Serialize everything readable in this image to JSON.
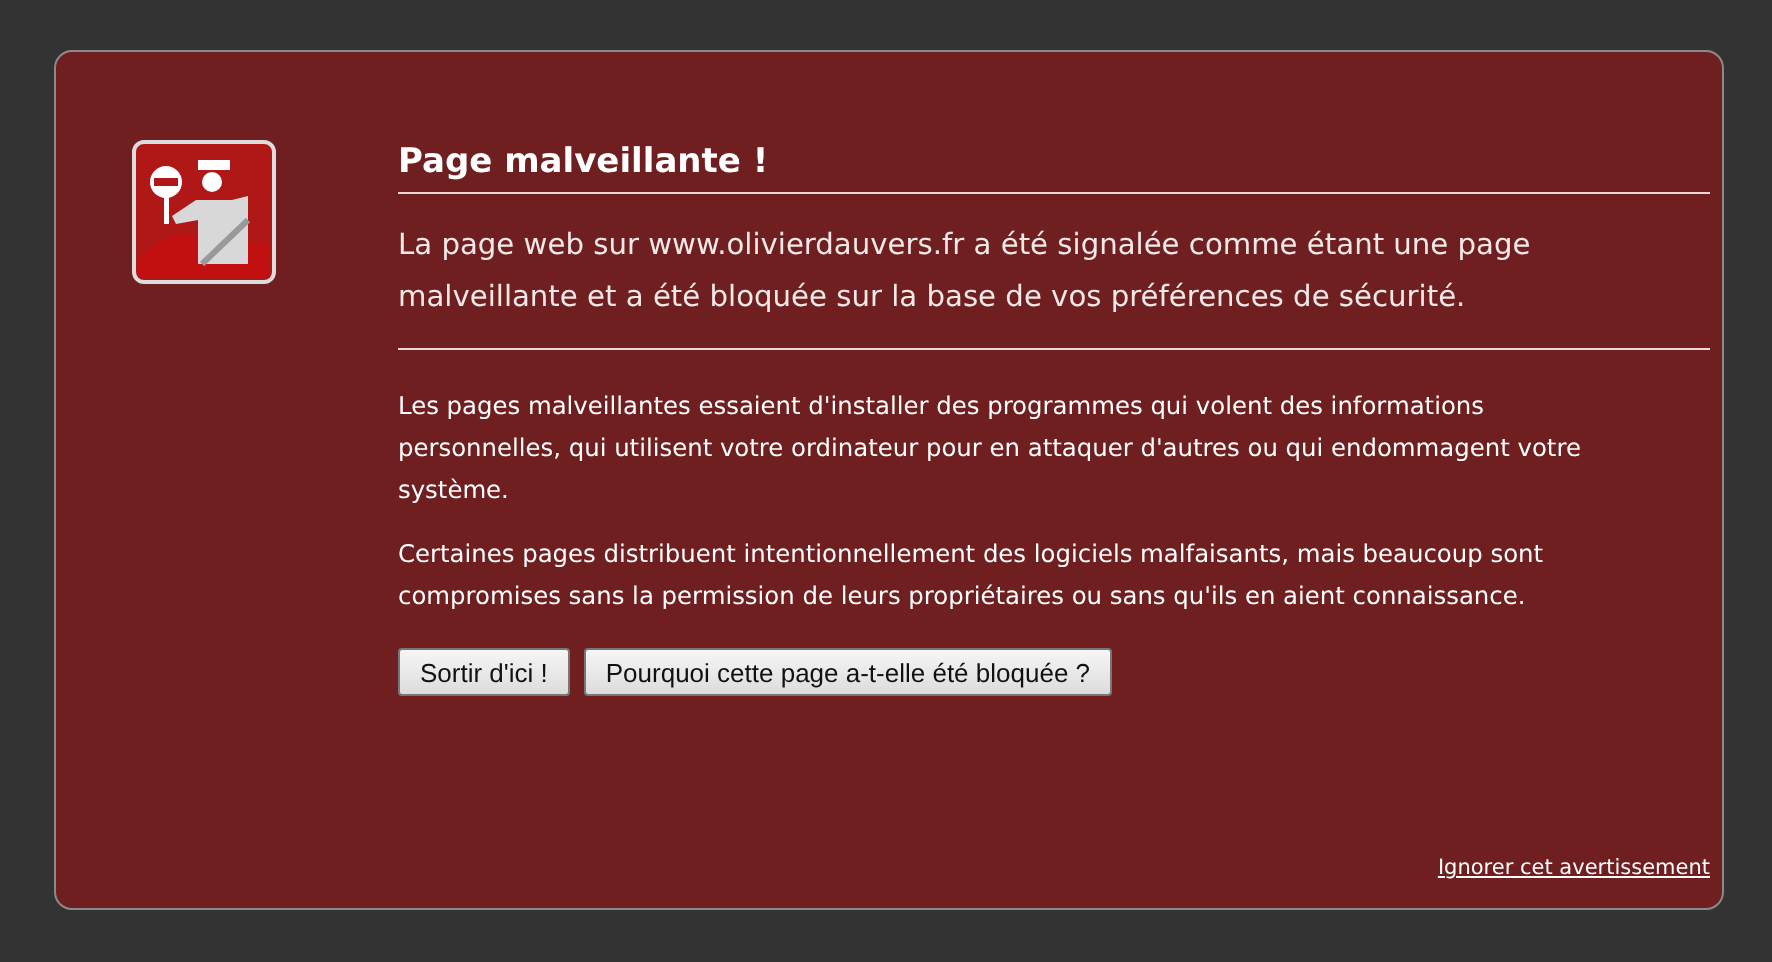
{
  "title": "Page malveillante !",
  "summary": "La page web sur www.olivierdauvers.fr a été signalée comme étant une page malveillante et a été bloquée sur la base de vos préférences de sécurité.",
  "paragraphs": [
    "Les pages malveillantes essaient d'installer des programmes qui volent des informations personnelles, qui utilisent votre ordinateur pour en attaquer d'autres ou qui endommagent votre système.",
    "Certaines pages distribuent intentionnellement des logiciels malfaisants, mais beaucoup sont compromises sans la permission de leurs propriétaires ou sans qu'ils en aient connaissance."
  ],
  "buttons": [
    "Sortir d'ici !",
    "Pourquoi cette page a-t-elle été bloquée ?"
  ],
  "ignore_link": "Ignorer cet avertissement"
}
